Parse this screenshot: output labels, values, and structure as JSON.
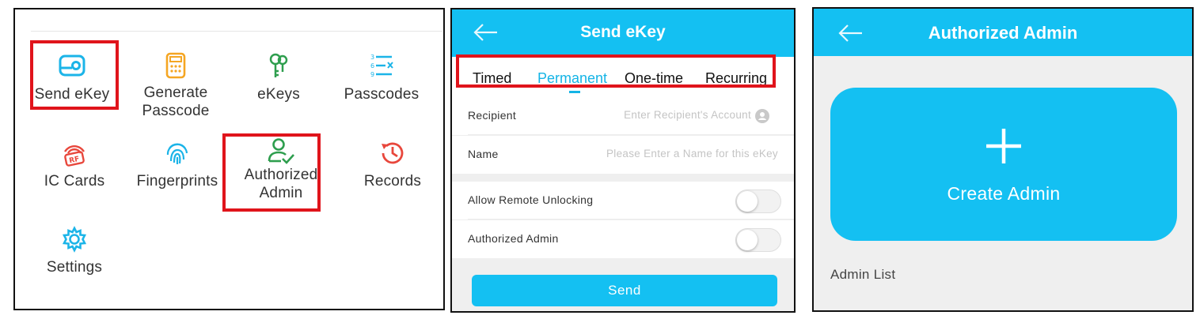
{
  "menu": {
    "items": [
      {
        "label": "Send eKey",
        "icon": "send-ekey-icon"
      },
      {
        "label": "Generate\nPasscode",
        "icon": "calculator-icon"
      },
      {
        "label": "eKeys",
        "icon": "keys-icon"
      },
      {
        "label": "Passcodes",
        "icon": "passcode-list-icon"
      },
      {
        "label": "IC Cards",
        "icon": "rf-card-icon"
      },
      {
        "label": "Fingerprints",
        "icon": "fingerprint-icon"
      },
      {
        "label": "Authorized\nAdmin",
        "icon": "user-check-icon"
      },
      {
        "label": "Records",
        "icon": "history-clock-icon"
      },
      {
        "label": "Settings",
        "icon": "gear-icon"
      }
    ]
  },
  "send_ekey": {
    "title": "Send eKey",
    "tabs": [
      {
        "label": "Timed",
        "active": false
      },
      {
        "label": "Permanent",
        "active": true
      },
      {
        "label": "One-time",
        "active": false
      },
      {
        "label": "Recurring",
        "active": false
      }
    ],
    "recipient": {
      "label": "Recipient",
      "placeholder": "Enter Recipient's Account"
    },
    "name": {
      "label": "Name",
      "placeholder": "Please Enter a Name for this eKey"
    },
    "remote_unlock": {
      "label": "Allow Remote Unlocking",
      "on": false
    },
    "authorized_admin": {
      "label": "Authorized Admin",
      "on": false
    },
    "send_label": "Send"
  },
  "authorized_admin": {
    "title": "Authorized Admin",
    "create_label": "Create Admin",
    "list_label": "Admin List"
  },
  "colors": {
    "accent": "#14c0f2",
    "highlight": "#e0141b",
    "orange_icon": "#f5a623",
    "green_icon": "#2e9e4e",
    "red_icon": "#e8473c"
  }
}
